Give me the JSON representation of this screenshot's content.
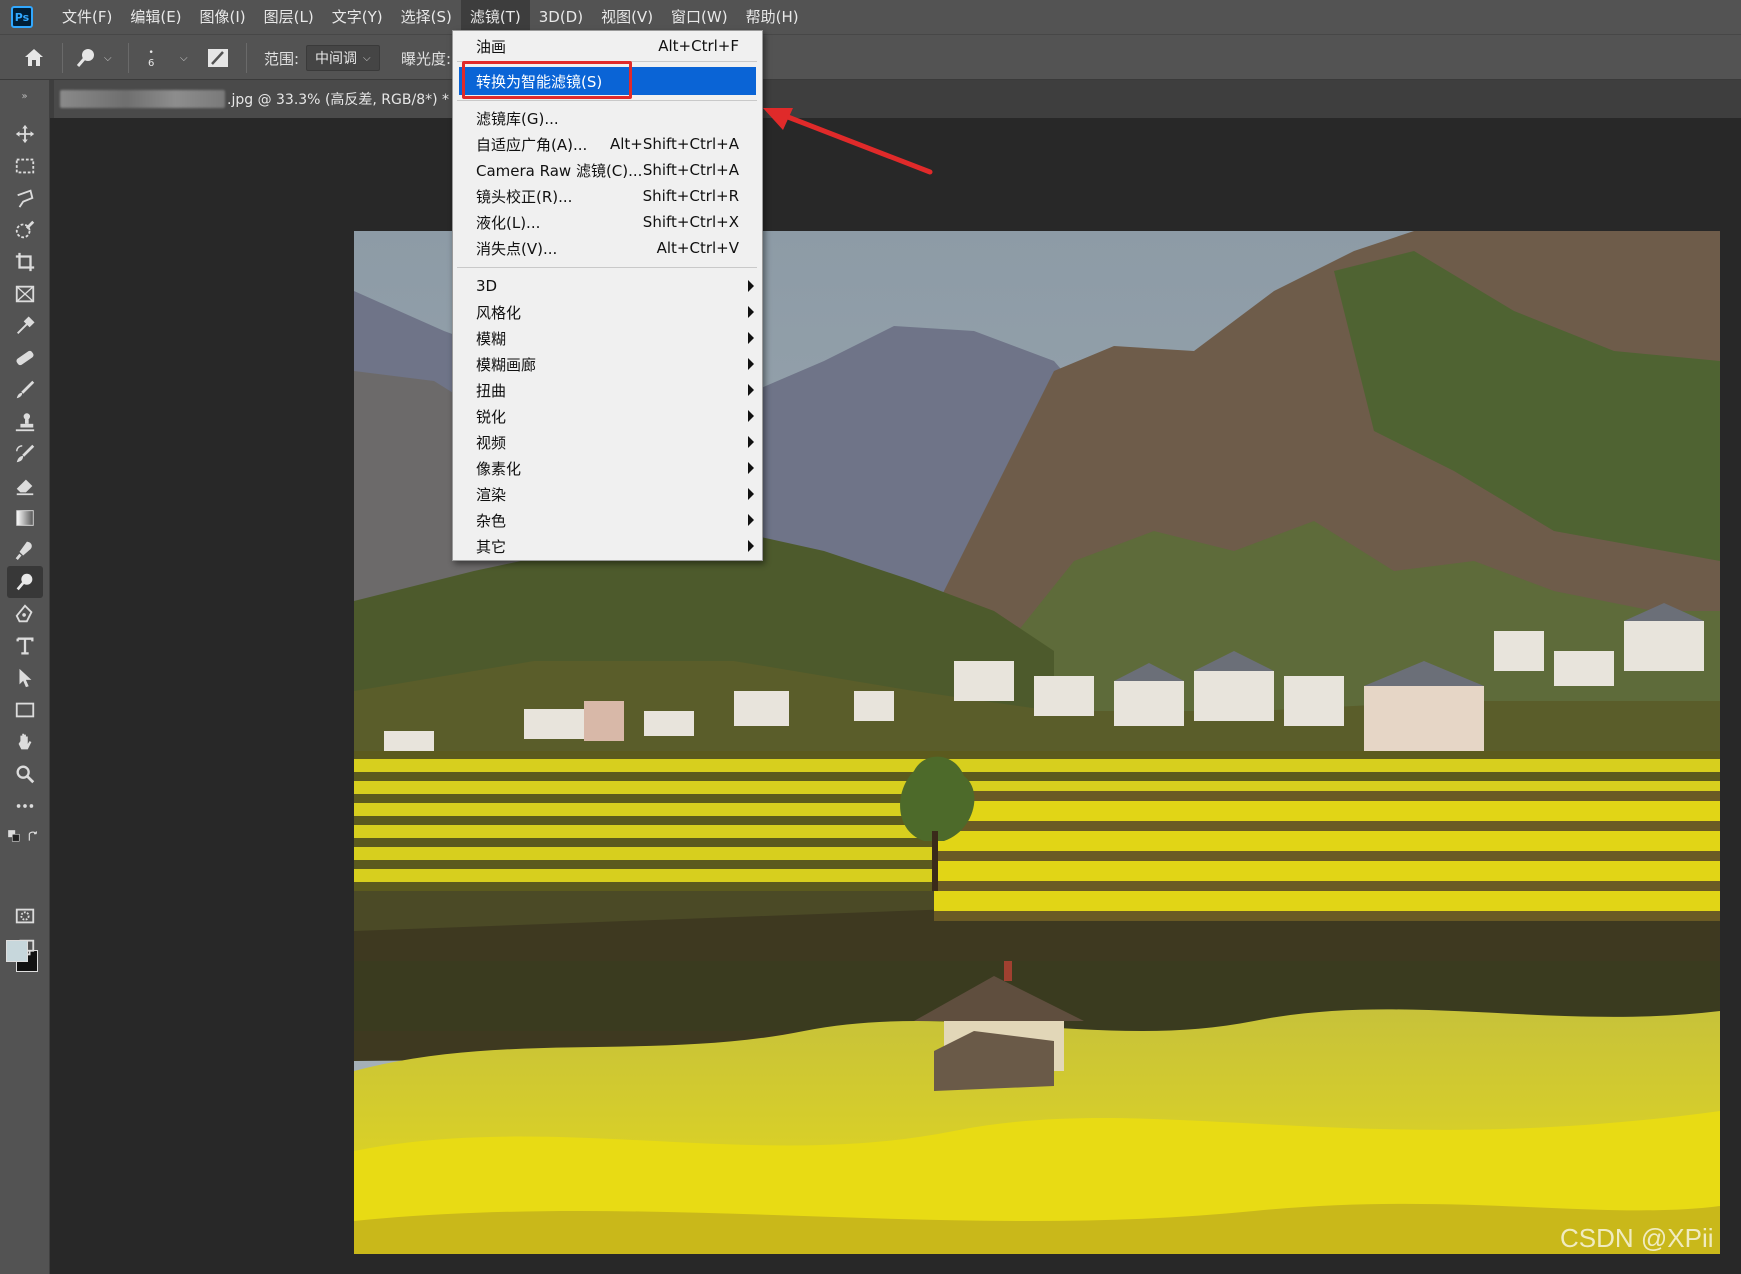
{
  "app": {
    "logo": "Ps",
    "watermark": "CSDN @XPii"
  },
  "menubar": {
    "items": [
      "文件(F)",
      "编辑(E)",
      "图像(I)",
      "图层(L)",
      "文字(Y)",
      "选择(S)",
      "滤镜(T)",
      "3D(D)",
      "视图(V)",
      "窗口(W)",
      "帮助(H)"
    ],
    "active_index": 6
  },
  "options_bar": {
    "brush_size": "6",
    "range_label": "范围:",
    "range_value": "中间调",
    "exposure_label": "曝光度:"
  },
  "document": {
    "tab_title": ".jpg @ 33.3% (高反差, RGB/8*) *"
  },
  "filter_menu": {
    "items": [
      {
        "label": "油画",
        "shortcut": "Alt+Ctrl+F"
      },
      {
        "label": "转换为智能滤镜(S)",
        "shortcut": "",
        "highlighted": true
      },
      {
        "label": "滤镜库(G)...",
        "shortcut": ""
      },
      {
        "label": "自适应广角(A)...",
        "shortcut": "Alt+Shift+Ctrl+A"
      },
      {
        "label": "Camera Raw 滤镜(C)...",
        "shortcut": "Shift+Ctrl+A"
      },
      {
        "label": "镜头校正(R)...",
        "shortcut": "Shift+Ctrl+R"
      },
      {
        "label": "液化(L)...",
        "shortcut": "Shift+Ctrl+X"
      },
      {
        "label": "消失点(V)...",
        "shortcut": "Alt+Ctrl+V"
      },
      {
        "label": "3D",
        "submenu": true
      },
      {
        "label": "风格化",
        "submenu": true
      },
      {
        "label": "模糊",
        "submenu": true
      },
      {
        "label": "模糊画廊",
        "submenu": true
      },
      {
        "label": "扭曲",
        "submenu": true
      },
      {
        "label": "锐化",
        "submenu": true
      },
      {
        "label": "视频",
        "submenu": true
      },
      {
        "label": "像素化",
        "submenu": true
      },
      {
        "label": "渲染",
        "submenu": true
      },
      {
        "label": "杂色",
        "submenu": true
      },
      {
        "label": "其它",
        "submenu": true
      }
    ]
  },
  "tools": [
    "move-tool",
    "marquee-tool",
    "lasso-tool",
    "quick-select-tool",
    "crop-tool",
    "frame-tool",
    "eyedropper-tool",
    "healing-brush-tool",
    "brush-tool",
    "clone-stamp-tool",
    "history-brush-tool",
    "eraser-tool",
    "gradient-tool",
    "smudge-tool",
    "dodge-tool",
    "pen-tool",
    "type-tool",
    "path-select-tool",
    "rectangle-tool",
    "hand-tool",
    "zoom-tool",
    "more-tools"
  ],
  "selected_tool": "dodge-tool",
  "colors": {
    "accent": "#0a64d6",
    "annotation": "#e02a2a",
    "foreground_swatch": "#c7d7dc",
    "background_swatch": "#111111"
  }
}
